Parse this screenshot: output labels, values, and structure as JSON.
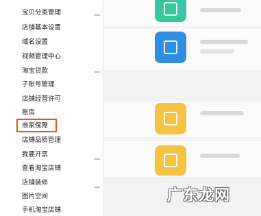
{
  "sidebar": {
    "items": [
      {
        "label": "宝贝分类管理"
      },
      {
        "label": "店铺基本设置"
      },
      {
        "label": "域名设置"
      },
      {
        "label": "视频管理中心"
      },
      {
        "label": "淘宝贷款"
      },
      {
        "label": "子账号管理"
      },
      {
        "label": "店铺经营许可"
      },
      {
        "label": "账房"
      },
      {
        "label": "商家保障"
      },
      {
        "label": "店铺品质管理"
      },
      {
        "label": "我要开票"
      },
      {
        "label": "查看淘宝店铺"
      },
      {
        "label": "店铺装修"
      },
      {
        "label": "图片空间"
      },
      {
        "label": "手机淘宝店铺"
      }
    ],
    "highlighted_item": "商家保障"
  },
  "main": {
    "tiles": [
      {
        "icon": "green-app-icon",
        "color": "#35c7a0"
      },
      {
        "icon": "blue-app-icon",
        "color": "#2f8fe0"
      },
      {
        "icon": "yellow-app-icon",
        "color": "#f5c242"
      },
      {
        "icon": "yellow-app-icon",
        "color": "#f5c242"
      }
    ]
  },
  "watermark": {
    "text": "广东龙网"
  },
  "colors": {
    "highlight_border": "#e8541f",
    "accent_tick": "#f1a7a7"
  }
}
